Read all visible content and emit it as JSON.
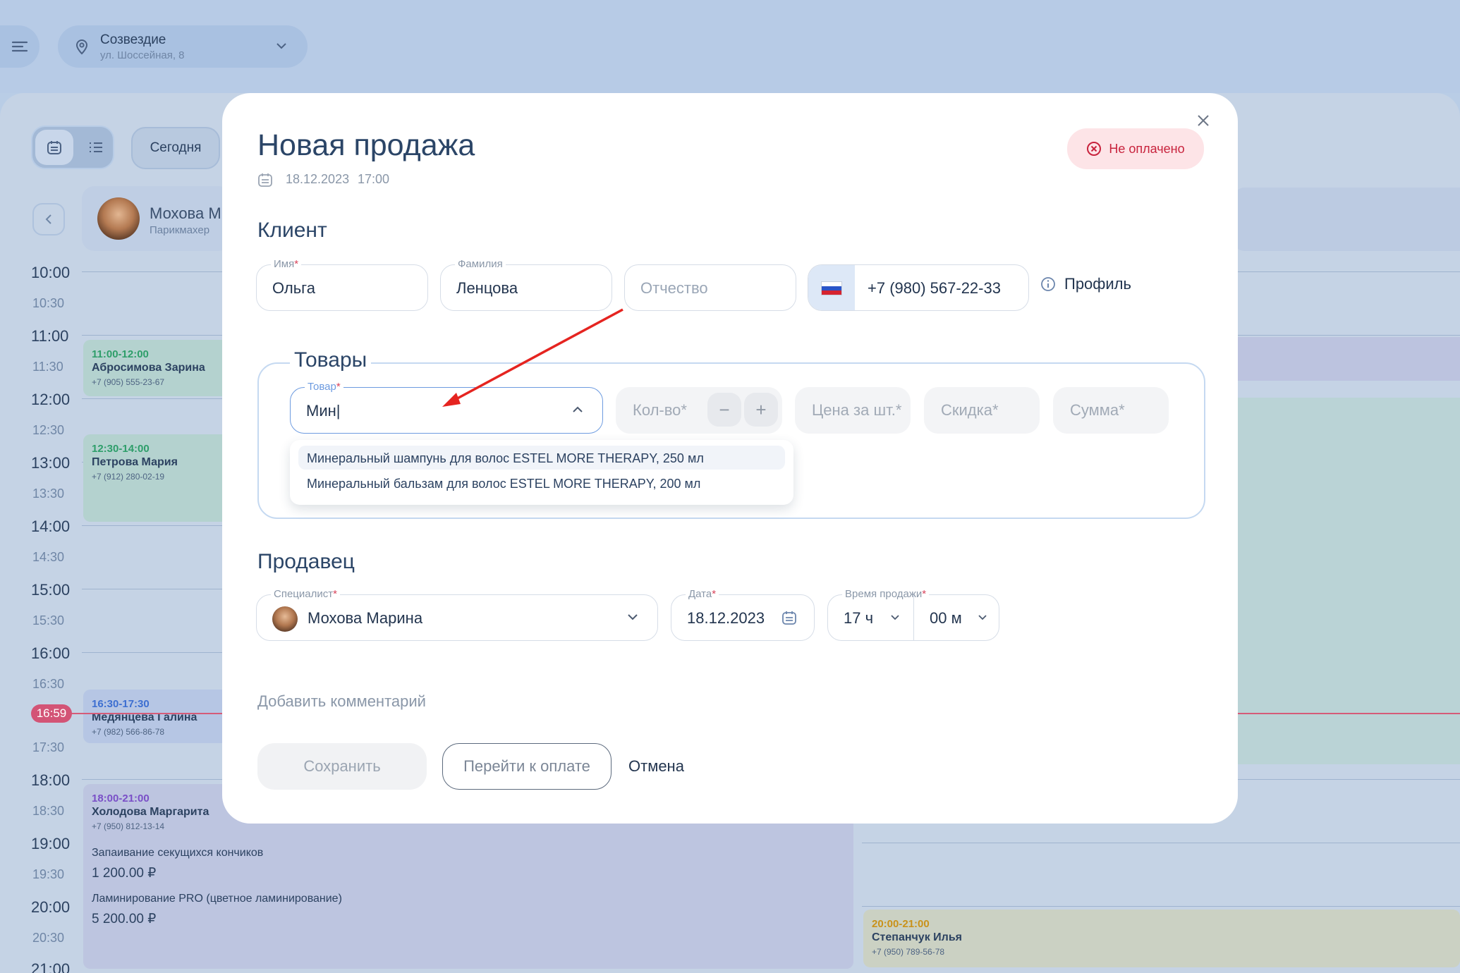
{
  "location": {
    "name": "Созвездие",
    "address": "ул. Шоссейная, 8"
  },
  "toolbar": {
    "today_label": "Сегодня"
  },
  "staff_card": {
    "name": "Мохова М",
    "role": "Парикмахер"
  },
  "timeline": {
    "hours": [
      "10:00",
      "11:00",
      "12:00",
      "13:00",
      "14:00",
      "15:00",
      "16:00",
      "18:00",
      "19:00",
      "20:00",
      "21:00"
    ],
    "half_hours": [
      "10:30",
      "11:30",
      "12:30",
      "13:30",
      "14:30",
      "15:30",
      "16:30",
      "17:30",
      "18:30",
      "19:30",
      "20:30"
    ],
    "now": "16:59"
  },
  "appointments": [
    {
      "time": "11:00-12:00",
      "name": "Абросимова Зарина",
      "phone": "+7 (905) 555-23-67",
      "color": "#2e9e6a"
    },
    {
      "time": "12:30-14:00",
      "name": "Петрова Мария",
      "phone": "+7 (912) 280-02-19",
      "color": "#2e9e6a"
    },
    {
      "time": "16:30-17:30",
      "name": "Медянцева Галина",
      "phone": "+7 (982) 566-86-78",
      "color": "#3d6fd1"
    },
    {
      "time": "18:00-21:00",
      "name": "Холодова Маргарита",
      "phone": "+7 (950) 812-13-14",
      "color": "#7a4fc7",
      "services": [
        {
          "name": "Запаивание секущихся кончиков",
          "price": "1 200.00 ₽"
        },
        {
          "name": "Ламинирование PRO (цветное ламинирование)",
          "price": "5 200.00 ₽"
        }
      ]
    },
    {
      "time": "20:00-21:00",
      "name": "Степанчук Илья",
      "phone": "+7 (950) 789-56-78",
      "color": "#c9921a"
    }
  ],
  "modal": {
    "title": "Новая продажа",
    "date": "18.12.2023",
    "time": "17:00",
    "status_badge": "Не оплачено",
    "client": {
      "section_title": "Клиент",
      "first_name_label": "Имя",
      "first_name": "Ольга",
      "last_name_label": "Фамилия",
      "last_name": "Ленцова",
      "patronymic_placeholder": "Отчество",
      "phone": "+7 (980) 567-22-33",
      "profile_link": "Профиль"
    },
    "goods": {
      "section_title": "Товары",
      "product_label": "Товар",
      "product_query": "Мин|",
      "qty_placeholder": "Кол-во*",
      "price_placeholder": "Цена за шт.*",
      "discount_placeholder": "Скидка*",
      "sum_placeholder": "Сумма*",
      "suggestions": [
        "Минеральный шампунь для волос ESTEL MORE THERAPY, 250 мл",
        "Минеральный бальзам для волос ESTEL MORE THERAPY, 200 мл"
      ]
    },
    "seller": {
      "section_title": "Продавец",
      "specialist_label": "Специалист",
      "specialist": "Мохова Марина",
      "date_label": "Дата",
      "date": "18.12.2023",
      "time_label": "Время продажи",
      "hours": "17 ч",
      "minutes": "00 м"
    },
    "add_comment": "Добавить комментарий",
    "buttons": {
      "save": "Сохранить",
      "pay": "Перейти к оплате",
      "cancel": "Отмена"
    }
  },
  "colors": {
    "accent": "#2b4567",
    "danger": "#c8233d",
    "annotation_arrow": "#e52420"
  }
}
